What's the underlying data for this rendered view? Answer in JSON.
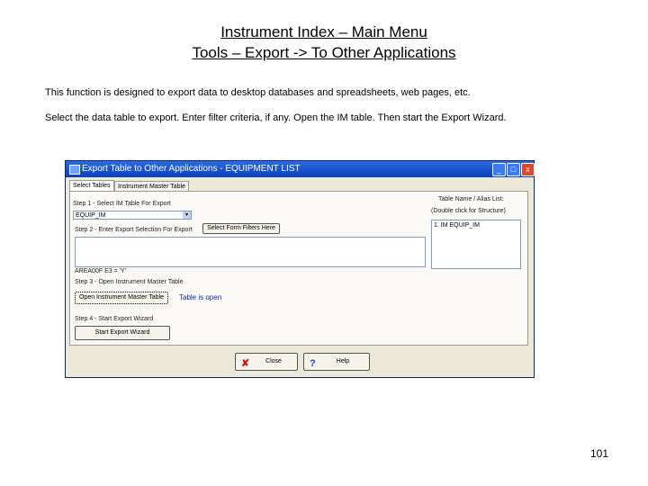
{
  "slide": {
    "title_line1": "Instrument Index – Main Menu",
    "title_line2": "Tools – Export -> To Other Applications",
    "para1": "This function is designed to export data to desktop databases and spreadsheets, web pages, etc.",
    "para2": "Select the data table to export.  Enter filter criteria, if any.  Open the IM table.  Then start the Export Wizard.",
    "page_number": "101"
  },
  "window": {
    "title": "Export Table to Other Applications - EQUIPMENT LIST",
    "min_label": "_",
    "max_label": "□",
    "close_label": "x",
    "tabs": [
      "Select Tables",
      "Instrument Master Table"
    ],
    "step1_label": "Step 1 - Select IM Table For Export",
    "table_select_value": "EQUIP_IM",
    "select_arrow": "▾",
    "step2_label": "Step 2 - Enter Export Selection For Export",
    "select_filters_button": "Select Form Filters Here",
    "alias_list_label": "Table Name / Alias List:",
    "alias_hint": "(Double click for Structure)",
    "alias_items": [
      "1. IM  EQUIP_IM"
    ],
    "filter_text": "",
    "unit_filter": "AREA00F E3   = 'Y'",
    "step3_label": "Step 3 - Open Instrument Master Table",
    "open_im_button": "Open Instrument Master Table",
    "table_status": "Table is open",
    "step4_label": "Step 4 - Start Export Wizard",
    "start_wizard_button": "Start Export Wizard",
    "close_button": "Close",
    "help_button": "Help",
    "close_icon_glyph": "✘",
    "help_icon_glyph": "?"
  }
}
